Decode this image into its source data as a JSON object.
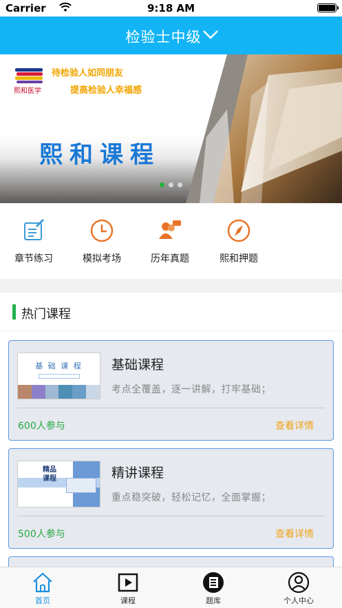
{
  "status_bar": {
    "carrier": "Carrier",
    "time": "9:18 AM"
  },
  "header": {
    "title": "检验士中级"
  },
  "banner": {
    "logo_text": "熙和医学",
    "slogan_line1": "待检验人如同朋友",
    "slogan_line2": "提高检验人幸福感",
    "headline": "熙和课程",
    "page_count": 3,
    "active_page": 1
  },
  "quick_menu": [
    {
      "label": "章节练习",
      "icon": "pencil-edit-icon"
    },
    {
      "label": "模拟考场",
      "icon": "clock-icon"
    },
    {
      "label": "历年真题",
      "icon": "people-chat-icon"
    },
    {
      "label": "熙和押题",
      "icon": "compass-icon"
    }
  ],
  "hot_section": {
    "title": "热门课程"
  },
  "courses": [
    {
      "title": "基础课程",
      "desc": "考点全覆盖，逐一讲解，打牢基础；",
      "participants": "600人参与",
      "detail": "查看详情",
      "thumb_text": "基 础 课 程"
    },
    {
      "title": "精讲课程",
      "desc": "重点稳突破，轻松记忆，全面掌握；",
      "participants": "500人参与",
      "detail": "查看详情",
      "thumb_text": "精品课程"
    }
  ],
  "tabs": [
    {
      "label": "首页",
      "icon": "home-icon",
      "active": true
    },
    {
      "label": "课程",
      "icon": "play-icon",
      "active": false
    },
    {
      "label": "题库",
      "icon": "question-bank-icon",
      "active": false
    },
    {
      "label": "个人中心",
      "icon": "user-icon",
      "active": false
    }
  ],
  "colors": {
    "nav_blue": "#12b4f6",
    "accent_green": "#22b14c",
    "accent_orange": "#f0a31b",
    "tab_active": "#1a8fe0",
    "icon_orange": "#e8742a"
  }
}
